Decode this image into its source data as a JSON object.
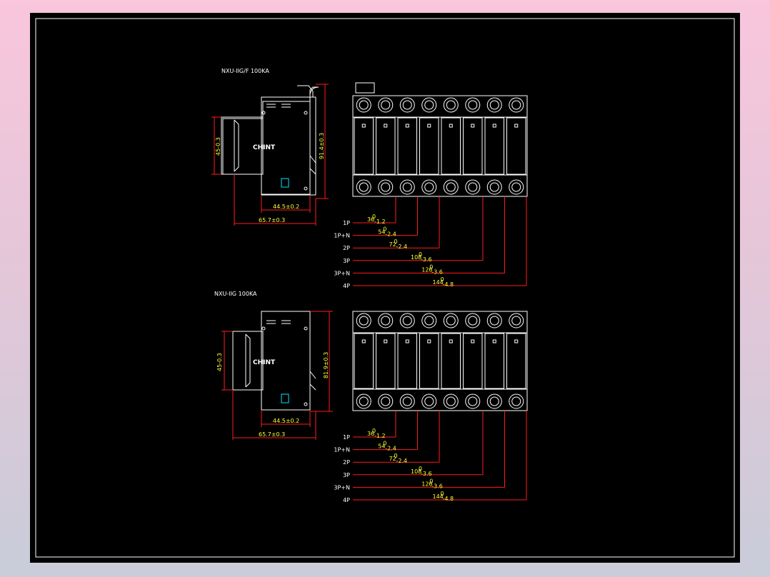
{
  "drawing": {
    "sections": [
      {
        "title": "NXU-IIG/F 100KA",
        "logo": "CHINT",
        "dims": {
          "height": "45-0.3",
          "height_sup": "0",
          "total_height": "91.4±0.3",
          "base_width": "44.5±0.2",
          "total_width": "65.7±0.3"
        },
        "poles": [
          {
            "label": "1P",
            "dim": "36",
            "tol": "0",
            "sub": "-1.2"
          },
          {
            "label": "1P+N",
            "dim": "54",
            "tol": "0",
            "sub": "-2.4"
          },
          {
            "label": "2P",
            "dim": "72",
            "tol": "0",
            "sub": "-2.4"
          },
          {
            "label": "3P",
            "dim": "108",
            "tol": "0",
            "sub": "-3.6"
          },
          {
            "label": "3P+N",
            "dim": "126",
            "tol": "0",
            "sub": "-3.6"
          },
          {
            "label": "4P",
            "dim": "144",
            "tol": "0",
            "sub": "-4.8"
          }
        ]
      },
      {
        "title": "NXU-IIG 100KA",
        "logo": "CHINT",
        "dims": {
          "height": "45-0.3",
          "height_sup": "0",
          "total_height": "81.9±0.3",
          "base_width": "44.5±0.2",
          "total_width": "65.7±0.3"
        },
        "poles": [
          {
            "label": "1P",
            "dim": "36",
            "tol": "0",
            "sub": "-1.2"
          },
          {
            "label": "1P+N",
            "dim": "54",
            "tol": "0",
            "sub": "-2.4"
          },
          {
            "label": "2P",
            "dim": "72",
            "tol": "0",
            "sub": "-2.4"
          },
          {
            "label": "3P",
            "dim": "108",
            "tol": "0",
            "sub": "-3.6"
          },
          {
            "label": "3P+N",
            "dim": "126",
            "tol": "0",
            "sub": "-3.6"
          },
          {
            "label": "4P",
            "dim": "144",
            "tol": "0",
            "sub": "-4.8"
          }
        ]
      }
    ]
  },
  "colors": {
    "background": "#000000",
    "lines": "#ffffff",
    "dimensions": "#ff1b1b",
    "dimension_text": "#ffff33",
    "accent": "#00e5ff"
  }
}
